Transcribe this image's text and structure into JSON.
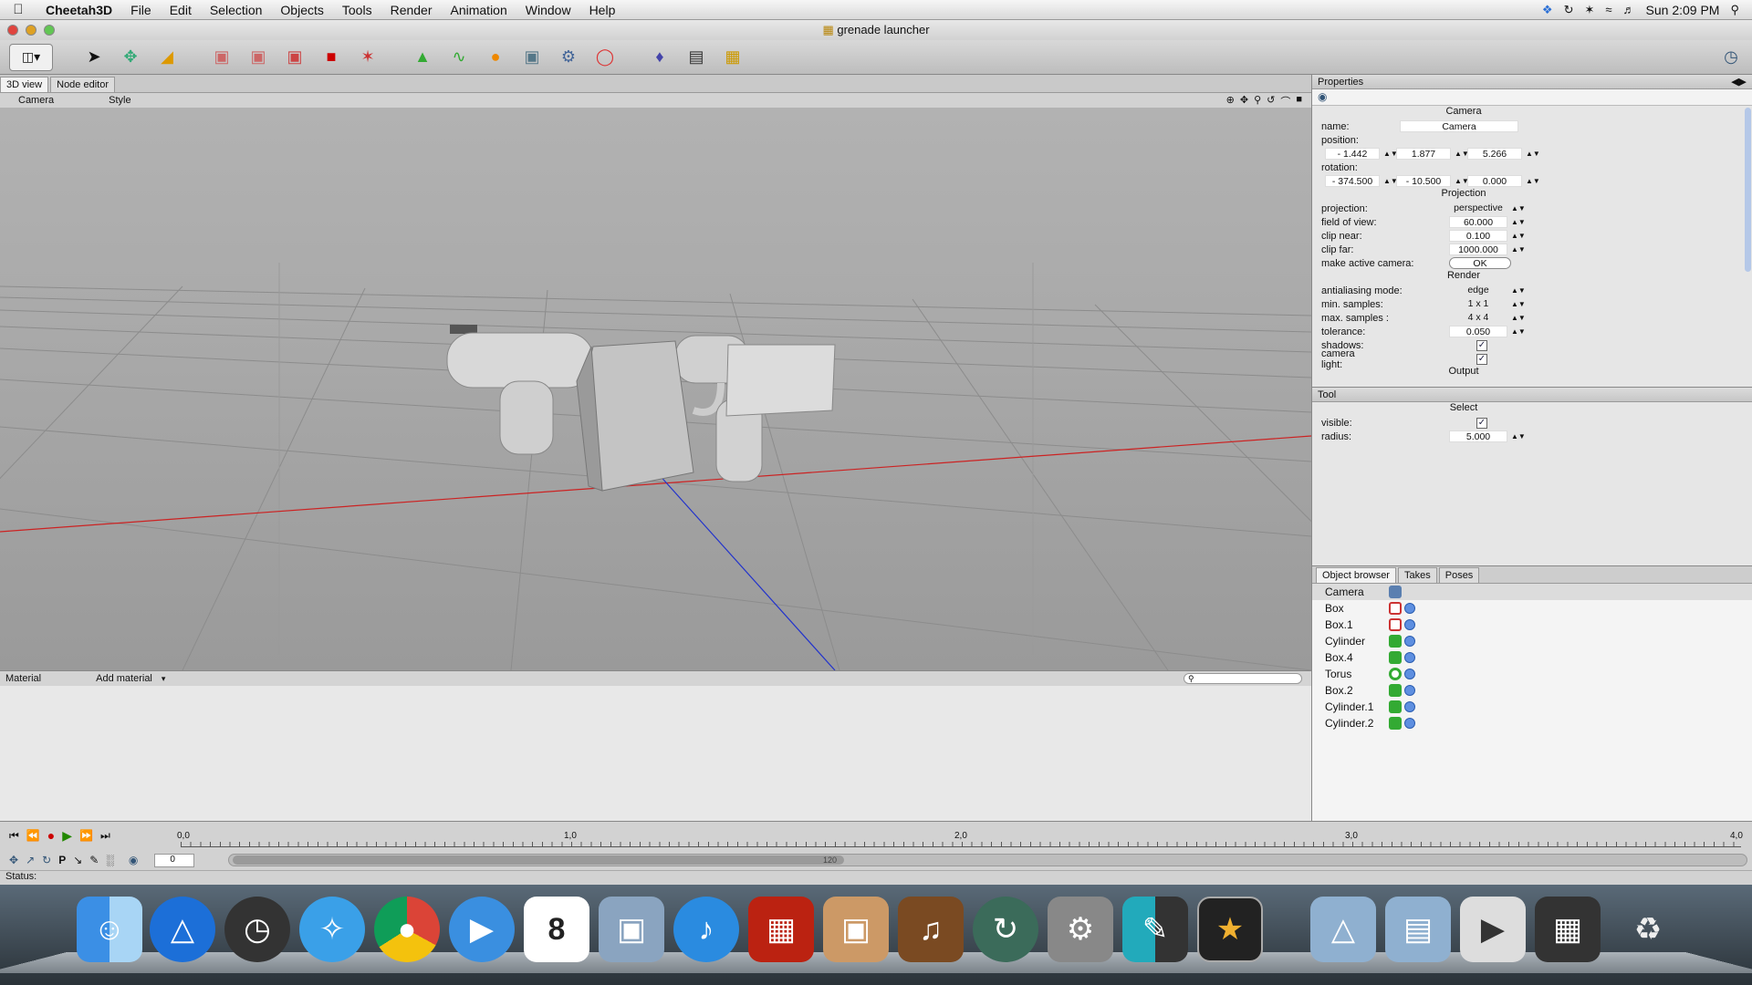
{
  "menubar": {
    "apple": "",
    "items": [
      "Cheetah3D",
      "File",
      "Edit",
      "Selection",
      "Objects",
      "Tools",
      "Render",
      "Animation",
      "Window",
      "Help"
    ],
    "clock": "Sun 2:09 PM"
  },
  "window": {
    "title": "grenade launcher"
  },
  "viewport": {
    "tabs": [
      "3D view",
      "Node editor"
    ],
    "camera_menu": "Camera",
    "style_menu": "Style"
  },
  "material": {
    "label": "Material",
    "add_material": "Add material"
  },
  "properties": {
    "header": "Properties",
    "object_title": "Camera",
    "name_label": "name:",
    "name_value": "Camera",
    "position_label": "position:",
    "position": [
      "- 1.442",
      "1.877",
      "5.266"
    ],
    "rotation_label": "rotation:",
    "rotation": [
      "- 374.500",
      "- 10.500",
      "0.000"
    ],
    "projection_section": "Projection",
    "projection_label": "projection:",
    "projection_value": "perspective",
    "fov_label": "field of view:",
    "fov_value": "60.000",
    "clip_near_label": "clip near:",
    "clip_near_value": "0.100",
    "clip_far_label": "clip far:",
    "clip_far_value": "1000.000",
    "active_cam_label": "make active camera:",
    "ok_label": "OK",
    "render_section": "Render",
    "aa_label": "antialiasing mode:",
    "aa_value": "edge",
    "min_samples_label": "min. samples:",
    "min_samples_value": "1 x 1",
    "max_samples_label": "max. samples   :",
    "max_samples_value": "4 x 4",
    "tolerance_label": "tolerance:",
    "tolerance_value": "0.050",
    "shadows_label": "shadows:",
    "camlight_label": "camera light:",
    "output_section": "Output"
  },
  "tool": {
    "header": "Tool",
    "title": "Select",
    "visible_label": "visible:",
    "radius_label": "radius:",
    "radius_value": "5.000"
  },
  "object_browser": {
    "tabs": [
      "Object browser",
      "Takes",
      "Poses"
    ],
    "items": [
      {
        "name": "Camera",
        "icon": "camera-icon"
      },
      {
        "name": "Box",
        "icon": "box-icon"
      },
      {
        "name": "Box.1",
        "icon": "box-icon"
      },
      {
        "name": "Cylinder",
        "icon": "cylinder-icon"
      },
      {
        "name": "Box.4",
        "icon": "box-icon"
      },
      {
        "name": "Torus",
        "icon": "torus-icon"
      },
      {
        "name": "Box.2",
        "icon": "box-icon"
      },
      {
        "name": "Cylinder.1",
        "icon": "cylinder-icon"
      },
      {
        "name": "Cylinder.2",
        "icon": "cylinder-icon"
      }
    ]
  },
  "timeline": {
    "ruler_labels": [
      "0,0",
      "1,0",
      "2,0",
      "3,0",
      "4,0"
    ],
    "frame_value": "0",
    "slider_label": "120"
  },
  "status": {
    "label": "Status:"
  },
  "colors": {
    "accent": "#2a5db0",
    "x_axis": "#cc2222",
    "z_axis": "#2233cc"
  }
}
